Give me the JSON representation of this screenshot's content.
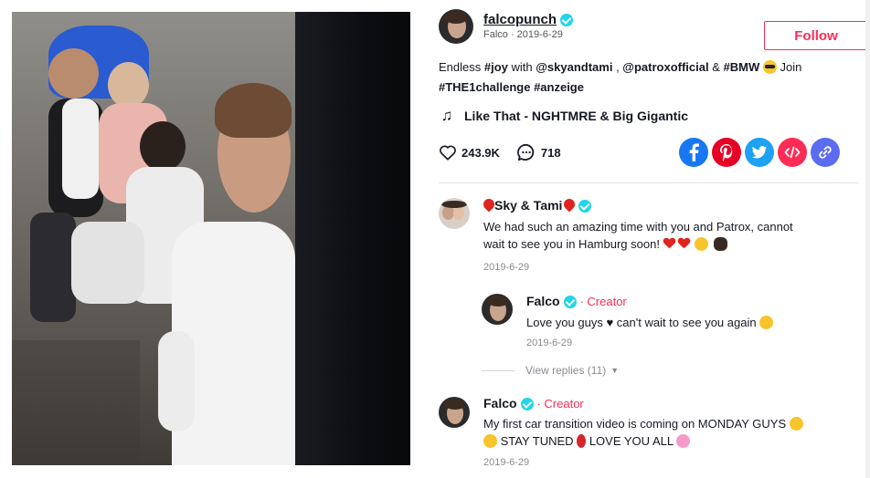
{
  "author": {
    "username": "falcopunch",
    "subtitle": "Falco · 2019-6-29",
    "follow_label": "Follow"
  },
  "caption": {
    "t1": "Endless ",
    "h_joy": "#joy",
    "t2": " with ",
    "m1": "@skyandtami",
    "t3": " , ",
    "m2": "@patroxofficial",
    "t4": " & ",
    "h_bmw": "#BMW",
    "t5": " Join",
    "h_challenge": "#THE1challenge",
    "h_anzeige": "#anzeige"
  },
  "music": {
    "title": "Like That - NGHTMRE & Big Gigantic",
    "icon": "music-note-icon"
  },
  "stats": {
    "likes": "243.9K",
    "comments": "718"
  },
  "share": [
    {
      "name": "facebook",
      "color": "#1877f2"
    },
    {
      "name": "pinterest",
      "color": "#e60023"
    },
    {
      "name": "twitter",
      "color": "#1da1f2"
    },
    {
      "name": "embed",
      "color": "#fe2c55"
    },
    {
      "name": "copy-link",
      "color": "#5b6cf0"
    }
  ],
  "comments": [
    {
      "name": "Sky & Tami",
      "text_line1": "We had such an amazing time with you and Patrox, cannot",
      "text_line2": "wait to see you in Hamburg soon!",
      "date": "2019-6-29"
    },
    {
      "name": "Falco",
      "creator": "· Creator",
      "text": "Love you guys ♥ can't wait to see you again",
      "date": "2019-6-29"
    },
    {
      "name": "Falco",
      "creator": "· Creator",
      "text_line1": "My first car transition video is coming on MONDAY GUYS",
      "text_line2_a": "STAY TUNED",
      "text_line2_b": "LOVE YOU ALL",
      "date": "2019-6-29"
    }
  ],
  "view_replies": "View replies (11)"
}
